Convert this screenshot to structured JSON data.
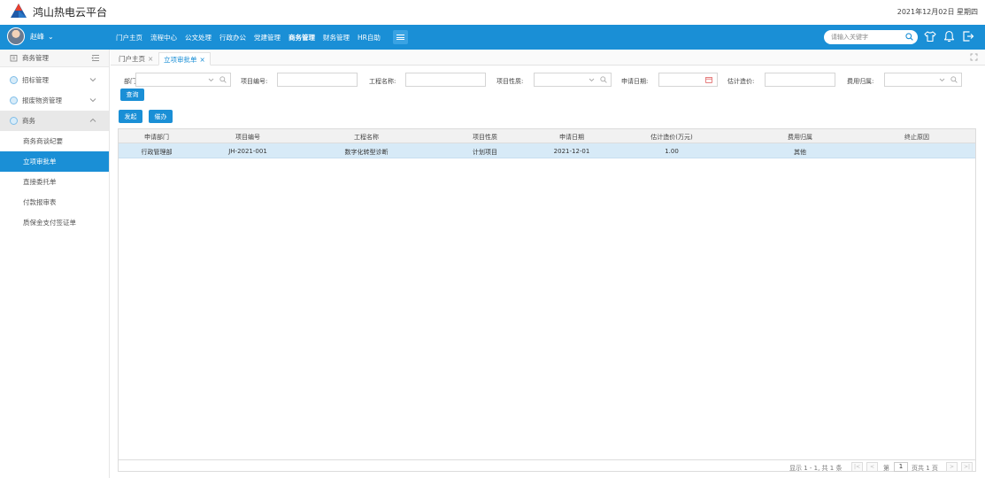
{
  "app": {
    "title": "鸿山热电云平台",
    "date": "2021年12月02日 星期四"
  },
  "user": {
    "name": "赵峰"
  },
  "nav": {
    "items": [
      "门户主页",
      "流程中心",
      "公文处理",
      "行政办公",
      "党建管理",
      "商务管理",
      "财务管理",
      "HR自助"
    ],
    "active_index": 5
  },
  "search": {
    "placeholder": "请输入关键字"
  },
  "sidebar": {
    "header": "商务管理",
    "groups": [
      {
        "label": "招标管理"
      },
      {
        "label": "报废物资管理"
      },
      {
        "label": "商务"
      }
    ],
    "subitems": [
      {
        "label": "商务商谈纪要"
      },
      {
        "label": "立项审批单"
      },
      {
        "label": "直接委托单"
      },
      {
        "label": "付款报审表"
      },
      {
        "label": "质保金支付签证单"
      }
    ],
    "active_sub": 1
  },
  "tabs": [
    {
      "label": "门户主页"
    },
    {
      "label": "立项审批单"
    }
  ],
  "filter": {
    "dept_label": "部门:",
    "project_no_label": "项目编号:",
    "project_name_label": "工程名称:",
    "project_type_label": "项目性质:",
    "apply_date_label": "申请日期:",
    "est_cost_label": "估计造价:",
    "cost_owner_label": "费用归属:",
    "query_button": "查询"
  },
  "actions": {
    "start_button": "发起",
    "delegate_button": "催办"
  },
  "table": {
    "columns": [
      "申请部门",
      "项目编号",
      "工程名称",
      "项目性质",
      "申请日期",
      "估计造价(万元)",
      "费用归属",
      "终止原因"
    ],
    "rows": [
      [
        "行政管理部",
        "JH-2021-001",
        "数字化转型诊断",
        "计划项目",
        "2021-12-01",
        "1.00",
        "其他",
        ""
      ]
    ]
  },
  "pager": {
    "summary": "显示 1 - 1, 共 1 条",
    "page_prefix": "第",
    "page_value": "1",
    "page_suffix": "页共 1 页"
  },
  "colors": {
    "primary": "#1a8fd6",
    "row_selected": "#d7eaf7"
  }
}
